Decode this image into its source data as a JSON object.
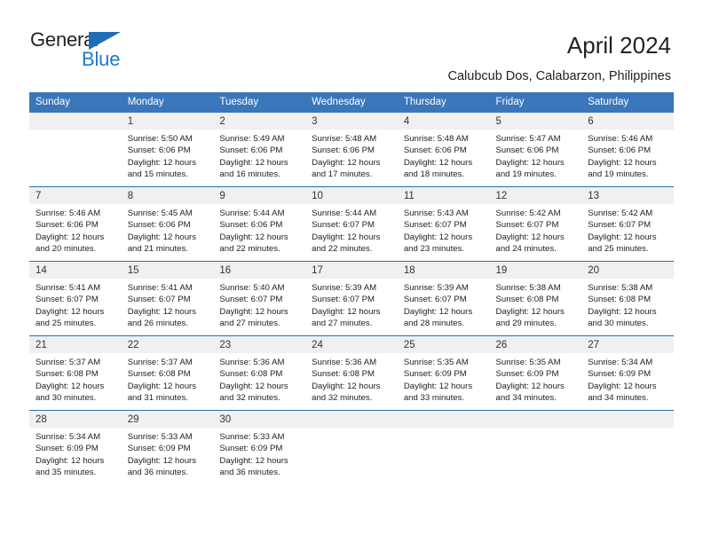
{
  "brand": {
    "name_part1": "General",
    "name_part2": "Blue",
    "triangle_color": "#1f6db5",
    "blue_color": "#1f7ac4"
  },
  "header": {
    "title": "April 2024",
    "subtitle": "Calubcub Dos, Calabarzon, Philippines"
  },
  "theme": {
    "header_blue": "#3a76ba",
    "divider_blue": "#2e6da8",
    "daystrip_gray": "#f0f0f0"
  },
  "weekdays": [
    "Sunday",
    "Monday",
    "Tuesday",
    "Wednesday",
    "Thursday",
    "Friday",
    "Saturday"
  ],
  "weeks": [
    [
      {
        "day": "",
        "sunrise": "",
        "sunset": "",
        "daylight1": "",
        "daylight2": "",
        "state": "empty"
      },
      {
        "day": "1",
        "sunrise": "Sunrise: 5:50 AM",
        "sunset": "Sunset: 6:06 PM",
        "daylight1": "Daylight: 12 hours",
        "daylight2": "and 15 minutes.",
        "state": "filled"
      },
      {
        "day": "2",
        "sunrise": "Sunrise: 5:49 AM",
        "sunset": "Sunset: 6:06 PM",
        "daylight1": "Daylight: 12 hours",
        "daylight2": "and 16 minutes.",
        "state": "filled"
      },
      {
        "day": "3",
        "sunrise": "Sunrise: 5:48 AM",
        "sunset": "Sunset: 6:06 PM",
        "daylight1": "Daylight: 12 hours",
        "daylight2": "and 17 minutes.",
        "state": "filled"
      },
      {
        "day": "4",
        "sunrise": "Sunrise: 5:48 AM",
        "sunset": "Sunset: 6:06 PM",
        "daylight1": "Daylight: 12 hours",
        "daylight2": "and 18 minutes.",
        "state": "filled"
      },
      {
        "day": "5",
        "sunrise": "Sunrise: 5:47 AM",
        "sunset": "Sunset: 6:06 PM",
        "daylight1": "Daylight: 12 hours",
        "daylight2": "and 19 minutes.",
        "state": "filled"
      },
      {
        "day": "6",
        "sunrise": "Sunrise: 5:46 AM",
        "sunset": "Sunset: 6:06 PM",
        "daylight1": "Daylight: 12 hours",
        "daylight2": "and 19 minutes.",
        "state": "filled"
      }
    ],
    [
      {
        "day": "7",
        "sunrise": "Sunrise: 5:46 AM",
        "sunset": "Sunset: 6:06 PM",
        "daylight1": "Daylight: 12 hours",
        "daylight2": "and 20 minutes.",
        "state": "filled"
      },
      {
        "day": "8",
        "sunrise": "Sunrise: 5:45 AM",
        "sunset": "Sunset: 6:06 PM",
        "daylight1": "Daylight: 12 hours",
        "daylight2": "and 21 minutes.",
        "state": "filled"
      },
      {
        "day": "9",
        "sunrise": "Sunrise: 5:44 AM",
        "sunset": "Sunset: 6:06 PM",
        "daylight1": "Daylight: 12 hours",
        "daylight2": "and 22 minutes.",
        "state": "filled"
      },
      {
        "day": "10",
        "sunrise": "Sunrise: 5:44 AM",
        "sunset": "Sunset: 6:07 PM",
        "daylight1": "Daylight: 12 hours",
        "daylight2": "and 22 minutes.",
        "state": "filled"
      },
      {
        "day": "11",
        "sunrise": "Sunrise: 5:43 AM",
        "sunset": "Sunset: 6:07 PM",
        "daylight1": "Daylight: 12 hours",
        "daylight2": "and 23 minutes.",
        "state": "filled"
      },
      {
        "day": "12",
        "sunrise": "Sunrise: 5:42 AM",
        "sunset": "Sunset: 6:07 PM",
        "daylight1": "Daylight: 12 hours",
        "daylight2": "and 24 minutes.",
        "state": "filled"
      },
      {
        "day": "13",
        "sunrise": "Sunrise: 5:42 AM",
        "sunset": "Sunset: 6:07 PM",
        "daylight1": "Daylight: 12 hours",
        "daylight2": "and 25 minutes.",
        "state": "filled"
      }
    ],
    [
      {
        "day": "14",
        "sunrise": "Sunrise: 5:41 AM",
        "sunset": "Sunset: 6:07 PM",
        "daylight1": "Daylight: 12 hours",
        "daylight2": "and 25 minutes.",
        "state": "filled"
      },
      {
        "day": "15",
        "sunrise": "Sunrise: 5:41 AM",
        "sunset": "Sunset: 6:07 PM",
        "daylight1": "Daylight: 12 hours",
        "daylight2": "and 26 minutes.",
        "state": "filled"
      },
      {
        "day": "16",
        "sunrise": "Sunrise: 5:40 AM",
        "sunset": "Sunset: 6:07 PM",
        "daylight1": "Daylight: 12 hours",
        "daylight2": "and 27 minutes.",
        "state": "filled"
      },
      {
        "day": "17",
        "sunrise": "Sunrise: 5:39 AM",
        "sunset": "Sunset: 6:07 PM",
        "daylight1": "Daylight: 12 hours",
        "daylight2": "and 27 minutes.",
        "state": "filled"
      },
      {
        "day": "18",
        "sunrise": "Sunrise: 5:39 AM",
        "sunset": "Sunset: 6:07 PM",
        "daylight1": "Daylight: 12 hours",
        "daylight2": "and 28 minutes.",
        "state": "filled"
      },
      {
        "day": "19",
        "sunrise": "Sunrise: 5:38 AM",
        "sunset": "Sunset: 6:08 PM",
        "daylight1": "Daylight: 12 hours",
        "daylight2": "and 29 minutes.",
        "state": "filled"
      },
      {
        "day": "20",
        "sunrise": "Sunrise: 5:38 AM",
        "sunset": "Sunset: 6:08 PM",
        "daylight1": "Daylight: 12 hours",
        "daylight2": "and 30 minutes.",
        "state": "filled"
      }
    ],
    [
      {
        "day": "21",
        "sunrise": "Sunrise: 5:37 AM",
        "sunset": "Sunset: 6:08 PM",
        "daylight1": "Daylight: 12 hours",
        "daylight2": "and 30 minutes.",
        "state": "filled"
      },
      {
        "day": "22",
        "sunrise": "Sunrise: 5:37 AM",
        "sunset": "Sunset: 6:08 PM",
        "daylight1": "Daylight: 12 hours",
        "daylight2": "and 31 minutes.",
        "state": "filled"
      },
      {
        "day": "23",
        "sunrise": "Sunrise: 5:36 AM",
        "sunset": "Sunset: 6:08 PM",
        "daylight1": "Daylight: 12 hours",
        "daylight2": "and 32 minutes.",
        "state": "filled"
      },
      {
        "day": "24",
        "sunrise": "Sunrise: 5:36 AM",
        "sunset": "Sunset: 6:08 PM",
        "daylight1": "Daylight: 12 hours",
        "daylight2": "and 32 minutes.",
        "state": "filled"
      },
      {
        "day": "25",
        "sunrise": "Sunrise: 5:35 AM",
        "sunset": "Sunset: 6:09 PM",
        "daylight1": "Daylight: 12 hours",
        "daylight2": "and 33 minutes.",
        "state": "filled"
      },
      {
        "day": "26",
        "sunrise": "Sunrise: 5:35 AM",
        "sunset": "Sunset: 6:09 PM",
        "daylight1": "Daylight: 12 hours",
        "daylight2": "and 34 minutes.",
        "state": "filled"
      },
      {
        "day": "27",
        "sunrise": "Sunrise: 5:34 AM",
        "sunset": "Sunset: 6:09 PM",
        "daylight1": "Daylight: 12 hours",
        "daylight2": "and 34 minutes.",
        "state": "filled"
      }
    ],
    [
      {
        "day": "28",
        "sunrise": "Sunrise: 5:34 AM",
        "sunset": "Sunset: 6:09 PM",
        "daylight1": "Daylight: 12 hours",
        "daylight2": "and 35 minutes.",
        "state": "filled"
      },
      {
        "day": "29",
        "sunrise": "Sunrise: 5:33 AM",
        "sunset": "Sunset: 6:09 PM",
        "daylight1": "Daylight: 12 hours",
        "daylight2": "and 36 minutes.",
        "state": "filled"
      },
      {
        "day": "30",
        "sunrise": "Sunrise: 5:33 AM",
        "sunset": "Sunset: 6:09 PM",
        "daylight1": "Daylight: 12 hours",
        "daylight2": "and 36 minutes.",
        "state": "filled"
      },
      {
        "day": "",
        "sunrise": "",
        "sunset": "",
        "daylight1": "",
        "daylight2": "",
        "state": "empty"
      },
      {
        "day": "",
        "sunrise": "",
        "sunset": "",
        "daylight1": "",
        "daylight2": "",
        "state": "empty"
      },
      {
        "day": "",
        "sunrise": "",
        "sunset": "",
        "daylight1": "",
        "daylight2": "",
        "state": "empty"
      },
      {
        "day": "",
        "sunrise": "",
        "sunset": "",
        "daylight1": "",
        "daylight2": "",
        "state": "empty"
      }
    ]
  ]
}
